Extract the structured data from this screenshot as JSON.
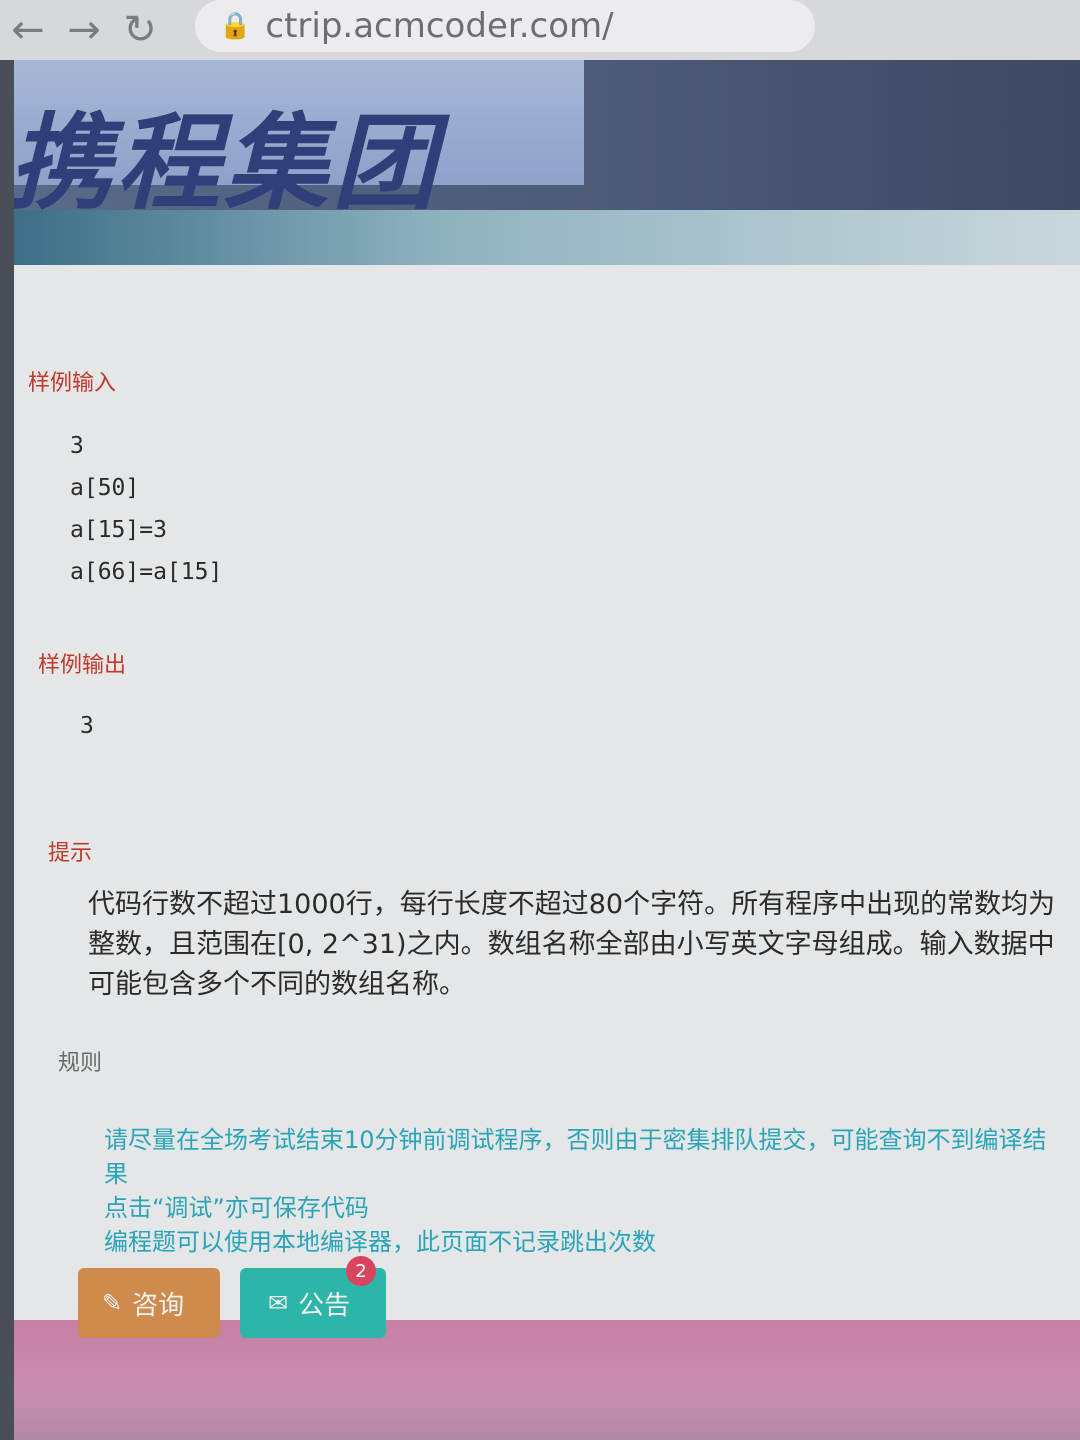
{
  "browser": {
    "url": "ctrip.acmcoder.com/",
    "back_glyph": "←",
    "forward_glyph": "→",
    "reload_glyph": "↻"
  },
  "banner": {
    "title": "携程集团"
  },
  "sample_input": {
    "title": "样例输入",
    "lines": [
      "3",
      "a[50]",
      "a[15]=3",
      "a[66]=a[15]"
    ]
  },
  "sample_output": {
    "title": "样例输出",
    "lines": [
      "3"
    ]
  },
  "hint": {
    "title": "提示",
    "text": "代码行数不超过1000行，每行长度不超过80个字符。所有程序中出现的常数均为整数，且范围在[0, 2^31)之内。数组名称全部由小写英文字母组成。输入数据中可能包含多个不同的数组名称。"
  },
  "rules": {
    "title": "规则",
    "items": [
      "请尽量在全场考试结束10分钟前调试程序，否则由于密集排队提交，可能查询不到编译结果",
      "点击“调试”亦可保存代码",
      "编程题可以使用本地编译器，此页面不记录跳出次数"
    ]
  },
  "actions": {
    "consult_label": "咨询",
    "notice_label": "公告",
    "notice_badge": "2"
  },
  "colors": {
    "section_title": "#c0392b",
    "rules_text": "#2aa5b8",
    "consult_button": "#cf8a4e",
    "notice_button": "#2db5a7"
  }
}
